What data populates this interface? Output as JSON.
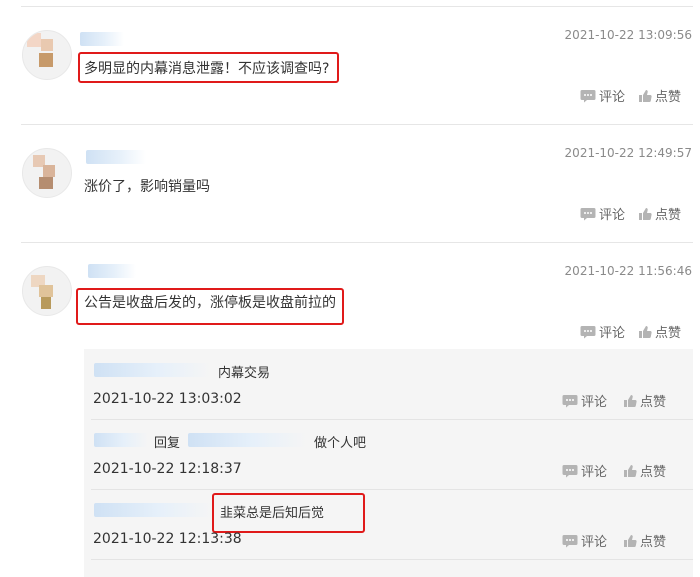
{
  "actions": {
    "comment_label": "评论",
    "like_label": "点赞"
  },
  "comments": [
    {
      "time": "2021-10-22 13:09:56",
      "content": "多明显的内幕消息泄露！不应该调查吗?"
    },
    {
      "time": "2021-10-22 12:49:57",
      "content": "涨价了，影响销量吗"
    },
    {
      "time": "2021-10-22 11:56:46",
      "content": "公告是收盘后发的，涨停板是收盘前拉的"
    }
  ],
  "replies": [
    {
      "text": "内幕交易",
      "time": "2021-10-22 13:03:02"
    },
    {
      "reply_word": "回复",
      "text": "做个人吧",
      "time": "2021-10-22 12:18:37"
    },
    {
      "text": "韭菜总是后知后觉",
      "time": "2021-10-22 12:13:38"
    }
  ],
  "colors": {
    "highlight_box": "#e01a1a",
    "reply_background": "#f5f5f5",
    "timestamp": "#8a8a8a"
  }
}
